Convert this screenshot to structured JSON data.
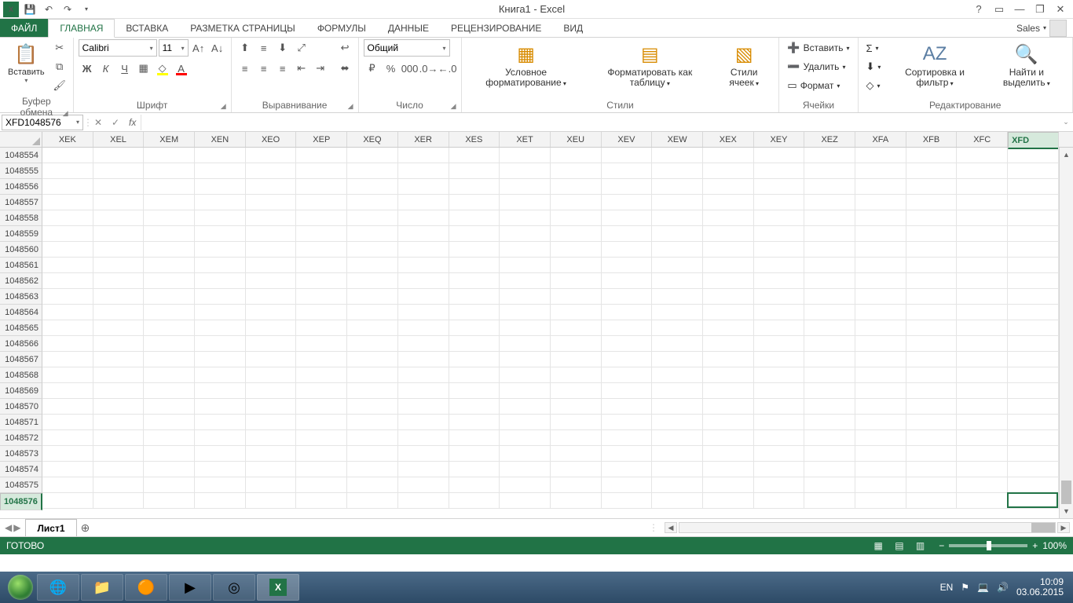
{
  "title": "Книга1 - Excel",
  "qat": {
    "save": "save-icon",
    "undo": "undo-icon",
    "redo": "redo-icon"
  },
  "winctl": {
    "help": "?",
    "ribbonopts": "▭",
    "min": "—",
    "restore": "❐",
    "close": "✕"
  },
  "tabs": {
    "file": "ФАЙЛ",
    "items": [
      "ГЛАВНАЯ",
      "ВСТАВКА",
      "РАЗМЕТКА СТРАНИЦЫ",
      "ФОРМУЛЫ",
      "ДАННЫЕ",
      "РЕЦЕНЗИРОВАНИЕ",
      "ВИД"
    ],
    "active": 0,
    "user": "Sales"
  },
  "ribbon": {
    "clipboard": {
      "paste": "Вставить",
      "label": "Буфер обмена"
    },
    "font": {
      "name": "Calibri",
      "size": "11",
      "bold": "Ж",
      "italic": "К",
      "underline": "Ч",
      "label": "Шрифт"
    },
    "align": {
      "label": "Выравнивание"
    },
    "number": {
      "format": "Общий",
      "label": "Число"
    },
    "styles": {
      "cond": "Условное форматирование",
      "cond2": "",
      "table": "Форматировать как таблицу",
      "table2": "",
      "cell": "Стили ячеек",
      "cell2": "",
      "label": "Стили"
    },
    "cells": {
      "insert": "Вставить",
      "delete": "Удалить",
      "format": "Формат",
      "label": "Ячейки"
    },
    "editing": {
      "sort": "Сортировка и фильтр",
      "sort2": "",
      "find": "Найти и выделить",
      "find2": "",
      "label": "Редактирование"
    }
  },
  "fbar": {
    "namebox": "XFD1048576",
    "cancel": "✕",
    "enter": "✓",
    "fx": "fx"
  },
  "grid": {
    "cols": [
      "XEK",
      "XEL",
      "XEM",
      "XEN",
      "XEO",
      "XEP",
      "XEQ",
      "XER",
      "XES",
      "XET",
      "XEU",
      "XEV",
      "XEW",
      "XEX",
      "XEY",
      "XEZ",
      "XFA",
      "XFB",
      "XFC",
      "XFD"
    ],
    "rows": [
      1048554,
      1048555,
      1048556,
      1048557,
      1048558,
      1048559,
      1048560,
      1048561,
      1048562,
      1048563,
      1048564,
      1048565,
      1048566,
      1048567,
      1048568,
      1048569,
      1048570,
      1048571,
      1048572,
      1048573,
      1048574,
      1048575,
      1048576
    ],
    "sel_col": "XFD",
    "sel_row": 1048576
  },
  "sheet": {
    "tab": "Лист1",
    "nav_prev": "◀",
    "nav_next": "▶"
  },
  "status": {
    "ready": "Готово",
    "zoom": "100%"
  },
  "taskbar": {
    "lang": "EN",
    "time": "10:09",
    "date": "03.06.2015"
  }
}
